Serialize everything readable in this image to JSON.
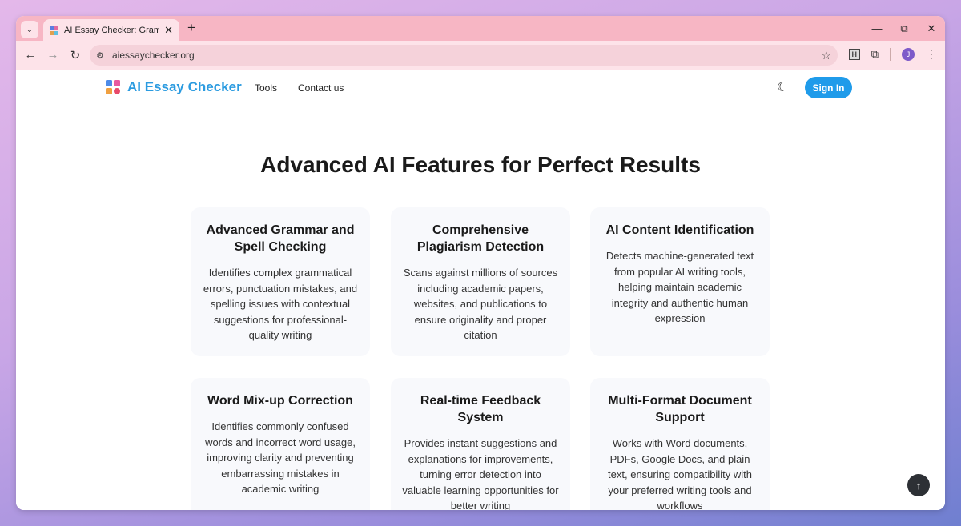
{
  "browser": {
    "tab_title": "AI Essay Checker: Grammar, Pla",
    "url": "aiessaychecker.org",
    "profile_initial": "J",
    "extension_label": "H"
  },
  "site": {
    "logo_text": "AI Essay Checker",
    "nav": [
      "Tools",
      "Contact us"
    ],
    "signin_label": "Sign In",
    "brand_color": "#1f9bea"
  },
  "section": {
    "title": "Advanced AI Features for Perfect Results"
  },
  "features": [
    {
      "title": "Advanced Grammar and Spell Checking",
      "desc": "Identifies complex grammatical errors, punctuation mistakes, and spelling issues with contextual suggestions for professional-quality writing"
    },
    {
      "title": "Comprehensive Plagiarism Detection",
      "desc": "Scans against millions of sources including academic papers, websites, and publications to ensure originality and proper citation"
    },
    {
      "title": "AI Content Identification",
      "desc": "Detects machine-generated text from popular AI writing tools, helping maintain academic integrity and authentic human expression"
    },
    {
      "title": "Word Mix-up Correction",
      "desc": "Identifies commonly confused words and incorrect word usage, improving clarity and preventing embarrassing mistakes in academic writing"
    },
    {
      "title": "Real-time Feedback System",
      "desc": "Provides instant suggestions and explanations for improvements, turning error detection into valuable learning opportunities for better writing"
    },
    {
      "title": "Multi-Format Document Support",
      "desc": "Works with Word documents, PDFs, Google Docs, and plain text, ensuring compatibility with your preferred writing tools and workflows"
    }
  ]
}
